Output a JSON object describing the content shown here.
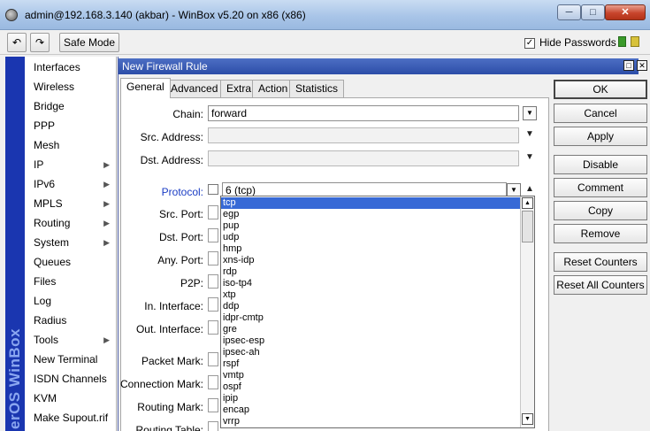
{
  "window": {
    "title": "admin@192.168.3.140 (akbar) - WinBox v5.20 on x86 (x86)",
    "min_glyph": "─",
    "max_glyph": "□",
    "close_glyph": "✕"
  },
  "toolbar": {
    "undo_glyph": "↶",
    "redo_glyph": "↷",
    "safe_mode_label": "Safe Mode",
    "hide_passwords_label": "Hide Passwords",
    "hide_passwords_checked": "✓"
  },
  "brand": {
    "text": "erOS WinBox"
  },
  "menu": {
    "items": [
      {
        "label": "Interfaces",
        "arrow": ""
      },
      {
        "label": "Wireless",
        "arrow": ""
      },
      {
        "label": "Bridge",
        "arrow": ""
      },
      {
        "label": "PPP",
        "arrow": ""
      },
      {
        "label": "Mesh",
        "arrow": ""
      },
      {
        "label": "IP",
        "arrow": "▶"
      },
      {
        "label": "IPv6",
        "arrow": "▶"
      },
      {
        "label": "MPLS",
        "arrow": "▶"
      },
      {
        "label": "Routing",
        "arrow": "▶"
      },
      {
        "label": "System",
        "arrow": "▶"
      },
      {
        "label": "Queues",
        "arrow": ""
      },
      {
        "label": "Files",
        "arrow": ""
      },
      {
        "label": "Log",
        "arrow": ""
      },
      {
        "label": "Radius",
        "arrow": ""
      },
      {
        "label": "Tools",
        "arrow": "▶"
      },
      {
        "label": "New Terminal",
        "arrow": ""
      },
      {
        "label": "ISDN Channels",
        "arrow": ""
      },
      {
        "label": "KVM",
        "arrow": ""
      },
      {
        "label": "Make Supout.rif",
        "arrow": ""
      }
    ]
  },
  "dialog": {
    "title": "New Firewall Rule",
    "tabs": [
      "General",
      "Advanced",
      "Extra",
      "Action",
      "Statistics"
    ],
    "fields": {
      "chain_label": "Chain:",
      "chain_value": "forward",
      "src_address_label": "Src. Address:",
      "dst_address_label": "Dst. Address:",
      "protocol_label": "Protocol:",
      "protocol_value": "6 (tcp)",
      "src_port_label": "Src. Port:",
      "dst_port_label": "Dst. Port:",
      "any_port_label": "Any. Port:",
      "p2p_label": "P2P:",
      "in_interface_label": "In. Interface:",
      "out_interface_label": "Out. Interface:",
      "packet_mark_label": "Packet Mark:",
      "connection_mark_label": "Connection Mark:",
      "routing_mark_label": "Routing Mark:",
      "routing_table_label": "Routing Table:"
    },
    "protocol_options": [
      "tcp",
      "egp",
      "pup",
      "udp",
      "hmp",
      "xns-idp",
      "rdp",
      "iso-tp4",
      "xtp",
      "ddp",
      "idpr-cmtp",
      "gre",
      "ipsec-esp",
      "ipsec-ah",
      "rspf",
      "vmtp",
      "ospf",
      "ipip",
      "encap",
      "vrrp"
    ],
    "selected_option": "tcp",
    "buttons": [
      "OK",
      "Cancel",
      "Apply",
      "Disable",
      "Comment",
      "Copy",
      "Remove",
      "Reset Counters",
      "Reset All Counters"
    ]
  },
  "colors": {
    "dialog_title_bg": "#2c4da8",
    "brand_strip": "#1a36b0",
    "selection": "#3769d6",
    "protocol_label": "#1a3cc4"
  }
}
